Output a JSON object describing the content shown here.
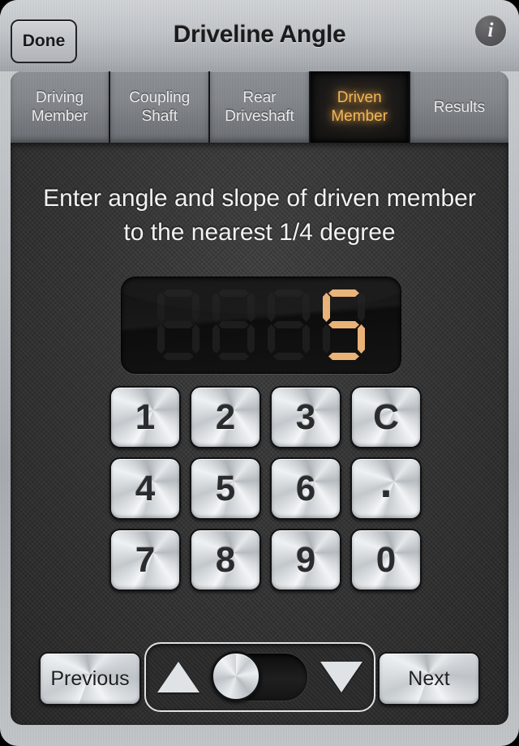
{
  "header": {
    "done_label": "Done",
    "title": "Driveline Angle",
    "info_icon": "info-circle-icon"
  },
  "tabs": [
    {
      "label": "Driving\nMember",
      "active": false
    },
    {
      "label": "Coupling\nShaft",
      "active": false
    },
    {
      "label": "Rear\nDriveshaft",
      "active": false
    },
    {
      "label": "Driven\nMember",
      "active": true
    },
    {
      "label": "Results",
      "active": false
    }
  ],
  "main": {
    "instructions": "Enter angle and slope of driven member to the nearest 1/4 degree",
    "display": {
      "value": "5",
      "digit_count": 4,
      "digits": [
        "",
        "",
        "",
        "5"
      ],
      "lit_color": "#e9b277",
      "unlit_color": "#1d1d1d",
      "background_color": "#121212"
    },
    "keypad": [
      {
        "label": "1",
        "name": "key-1"
      },
      {
        "label": "2",
        "name": "key-2"
      },
      {
        "label": "3",
        "name": "key-3"
      },
      {
        "label": "C",
        "name": "key-clear"
      },
      {
        "label": "4",
        "name": "key-4"
      },
      {
        "label": "5",
        "name": "key-5"
      },
      {
        "label": "6",
        "name": "key-6"
      },
      {
        "label": ".",
        "name": "key-decimal"
      },
      {
        "label": "7",
        "name": "key-7"
      },
      {
        "label": "8",
        "name": "key-8"
      },
      {
        "label": "9",
        "name": "key-9"
      },
      {
        "label": "0",
        "name": "key-0"
      }
    ]
  },
  "footer": {
    "previous_label": "Previous",
    "next_label": "Next",
    "stepper": {
      "up_icon": "triangle-up-icon",
      "down_icon": "triangle-down-icon",
      "toggle_position": "left"
    }
  },
  "colors": {
    "accent_amber": "#f3b757",
    "bezel_silver": "#bcc0c4",
    "panel_dark": "#323232"
  }
}
